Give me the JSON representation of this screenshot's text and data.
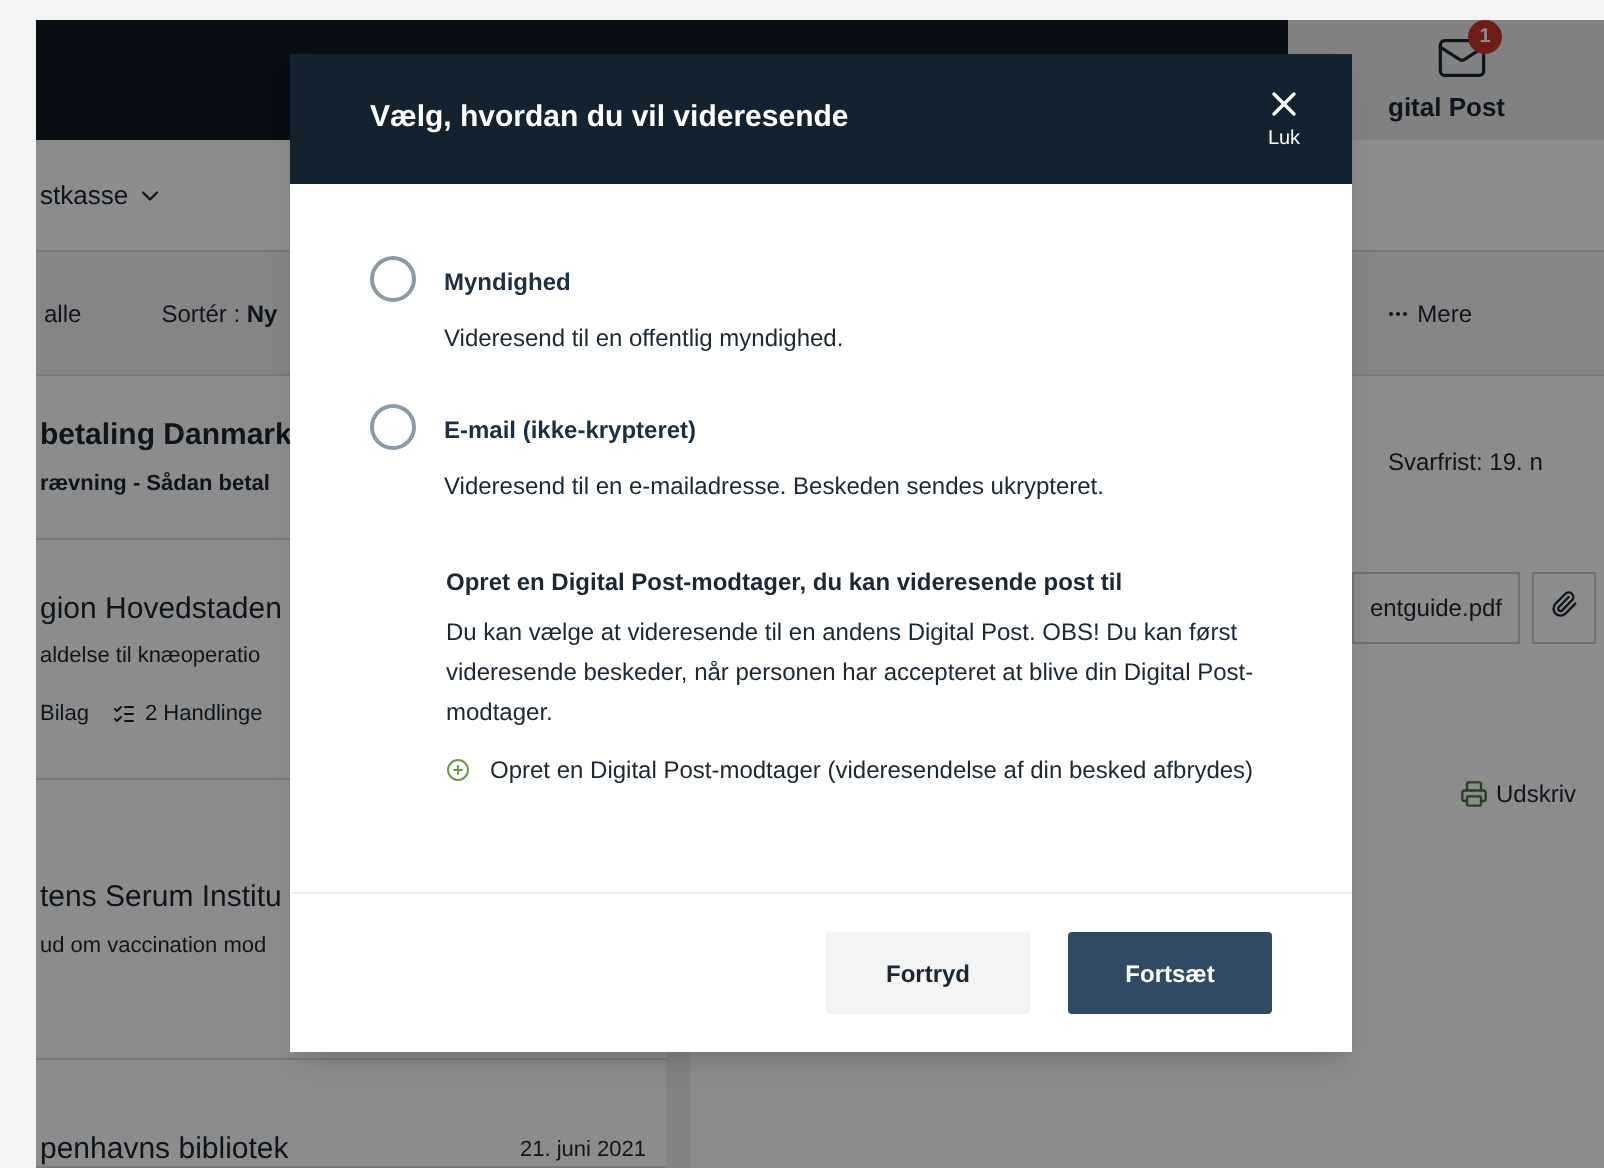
{
  "background_page": {
    "header": {
      "tab_label": "gital Post",
      "badge": "1"
    },
    "mailbox_selector": "stkasse",
    "toolbar": {
      "filter": "alle",
      "sort": "Sortér : **Ny**",
      "more": "Mere"
    },
    "messages": [
      {
        "kind": "bold",
        "sender": "betaling Danmark",
        "subject": "rævning - Sådan betal"
      },
      {
        "kind": "actions",
        "sender": "gion Hovedstaden",
        "subject": "aldelse til knæoperatio",
        "attachments": "Bilag",
        "actions": "2 Handlinge"
      },
      {
        "kind": "plain",
        "sender": "tens Serum Institu",
        "subject": "ud om vaccination mod"
      },
      {
        "kind": "dated",
        "sender": "penhavns bibliotek",
        "date": "21. juni 2021"
      }
    ],
    "detail": {
      "deadline": "Svarfrist: 19. n",
      "attachment": "entguide.pdf",
      "print": "Udskriv"
    }
  },
  "dialog": {
    "title": "Vælg, hvordan du vil videresende",
    "close_label": "Luk",
    "options": [
      {
        "label": "Myndighed",
        "description": "Videresend til en offentlig myndighed.",
        "selected": false
      },
      {
        "label": "E-mail (ikke-krypteret)",
        "description": "Videresend til en e-mailadresse. Beskeden sendes ukrypteret.",
        "selected": false
      }
    ],
    "recipient_section": {
      "heading": "Opret en Digital Post-modtager, du kan videresende post til",
      "text": "Du kan vælge at videresende til en andens Digital Post. OBS! Du kan først videresende beskeder, når personen har accepteret at blive din Digital Post-modtager.",
      "link": "Opret en Digital Post-modtager (videresendelse af din besked afbrydes)"
    },
    "buttons": [
      {
        "label": "Fortryd",
        "kind": "secondary"
      },
      {
        "label": "Fortsæt",
        "kind": "primary"
      }
    ]
  }
}
